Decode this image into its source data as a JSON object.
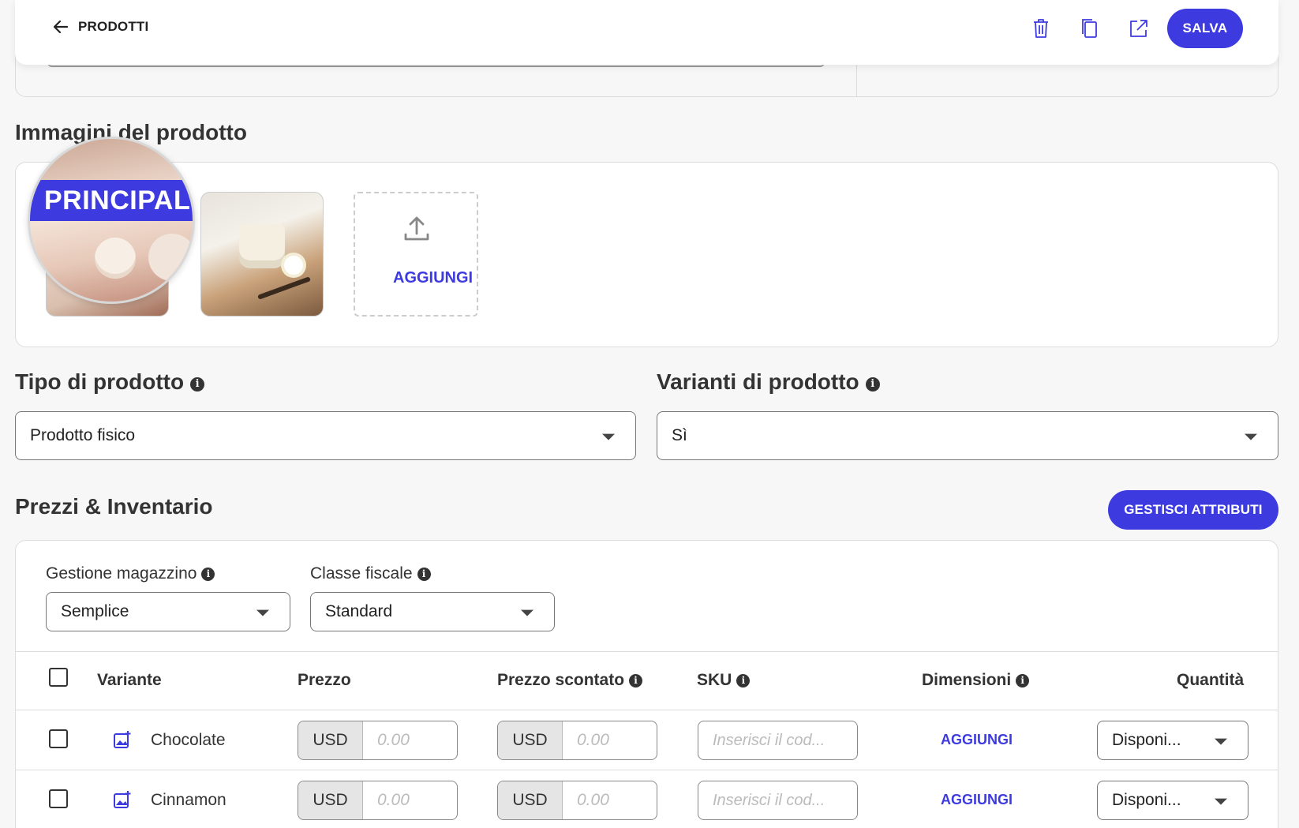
{
  "header": {
    "back_label": "PRODOTTI",
    "save_label": "SALVA"
  },
  "images": {
    "title": "Immagini del prodotto",
    "main_badge": "PRINCIPAL",
    "add_label": "AGGIUNGI"
  },
  "product_type": {
    "title": "Tipo di prodotto",
    "value": "Prodotto fisico"
  },
  "product_variants": {
    "title": "Varianti di prodotto",
    "value": "Sì"
  },
  "pricing": {
    "title": "Prezzi & Inventario",
    "manage_attributes_label": "GESTISCI ATTRIBUTI",
    "stock_management_label": "Gestione magazzino",
    "stock_management_value": "Semplice",
    "tax_class_label": "Classe fiscale",
    "tax_class_value": "Standard",
    "columns": {
      "variant": "Variante",
      "price": "Prezzo",
      "discounted_price": "Prezzo scontato",
      "sku": "SKU",
      "dimensions": "Dimensioni",
      "quantity": "Quantità"
    },
    "rows": [
      {
        "name": "Chocolate",
        "currency": "USD",
        "price_placeholder": "0.00",
        "discount_currency": "USD",
        "discount_placeholder": "0.00",
        "sku_placeholder": "Inserisci il cod...",
        "dimensions_action": "AGGIUNGI",
        "quantity_value": "Disponi..."
      },
      {
        "name": "Cinnamon",
        "currency": "USD",
        "price_placeholder": "0.00",
        "discount_currency": "USD",
        "discount_placeholder": "0.00",
        "sku_placeholder": "Inserisci il cod...",
        "dimensions_action": "AGGIUNGI",
        "quantity_value": "Disponi..."
      }
    ]
  },
  "colors": {
    "accent": "#3d3be0",
    "background": "#f7f7f7"
  }
}
